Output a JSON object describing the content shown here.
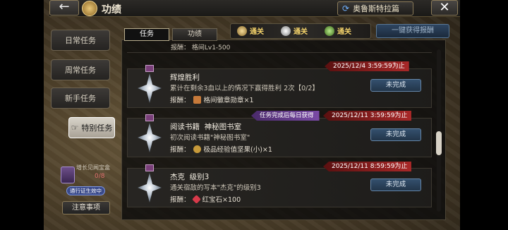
{
  "header": {
    "back_icon": "back-arrow-icon",
    "title": "功绩",
    "chapter_label": "奥鲁斯特拉篇",
    "close_icon": "close-x-icon"
  },
  "sidebar": {
    "items": [
      {
        "label": "日常任务",
        "active": false
      },
      {
        "label": "周常任务",
        "active": false
      },
      {
        "label": "新手任务",
        "active": false
      },
      {
        "label": "特别任务",
        "active": true
      }
    ],
    "growth": {
      "label": "增长见闻宝盒",
      "count": "0/8",
      "badge": "通行证生效中"
    },
    "notes_label": "注意事项"
  },
  "tabs": [
    {
      "label": "任务",
      "active": true
    },
    {
      "label": "功绩",
      "active": false
    }
  ],
  "clears": [
    {
      "label": "通关",
      "icon": "difficulty-1-icon",
      "color": "#c9a25a"
    },
    {
      "label": "通关",
      "icon": "difficulty-2-icon",
      "color": "#e6e6e6"
    },
    {
      "label": "通关",
      "icon": "difficulty-3-icon",
      "color": "#78b44a"
    }
  ],
  "one_click_label": "一键获得报酬",
  "partial_row_text": "报酬：  格间Lv1-500",
  "tasks": [
    {
      "name": "辉煌胜利",
      "desc": "累计在剩余3血以上的情况下赢得胜利 2次【0/2】",
      "reward_prefix": "报酬：",
      "reward": "格间徽章勋章×1",
      "reward_color": "#c77a3a",
      "status": "未完成",
      "deadline": "2025/12/4  3:59:59为止",
      "tag": ""
    },
    {
      "name": "阅读书籍  神秘图书室",
      "desc": "初次阅读书籍\"神秘图书室\"",
      "reward_prefix": "报酬：",
      "reward": "极品经验值坚果(小)×1",
      "reward_color": "#c79a3a",
      "status": "未完成",
      "deadline": "2025/12/11  3:59:59为止",
      "tag": "任务完成后每日获得"
    },
    {
      "name": "杰克  级别3",
      "desc": "通关宿敌的写本\"杰克\"的级别3",
      "reward_prefix": "报酬：",
      "reward": "红宝石×100",
      "reward_color": "#d83a4a",
      "status": "未完成",
      "deadline": "2025/12/11  8:59:59为止",
      "tag": ""
    }
  ]
}
